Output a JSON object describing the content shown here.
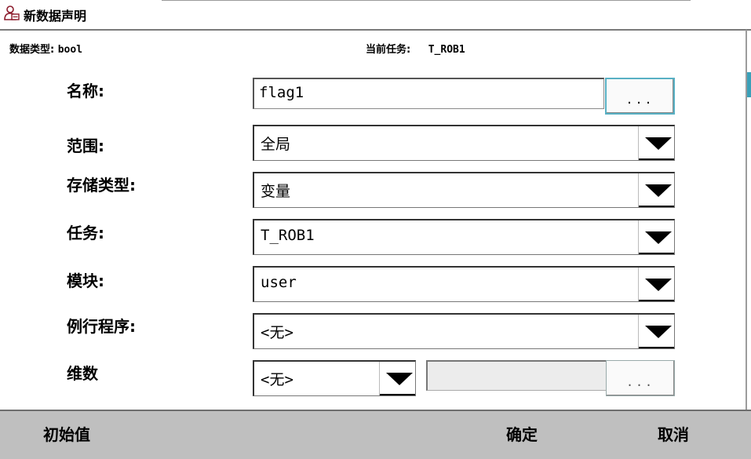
{
  "window": {
    "title": "新数据声明"
  },
  "info": {
    "data_type_label": "数据类型:",
    "data_type_value": "bool",
    "current_task_label": "当前任务:",
    "current_task_value": "T_ROB1"
  },
  "form": {
    "name": {
      "label": "名称:",
      "value": "flag1",
      "browse": "..."
    },
    "scope": {
      "label": "范围:",
      "value": "全局"
    },
    "storage": {
      "label": "存储类型:",
      "value": "变量"
    },
    "task": {
      "label": "任务:",
      "value": "T_ROB1"
    },
    "module": {
      "label": "模块:",
      "value": "user"
    },
    "routine": {
      "label": "例行程序:",
      "value": "<无>"
    },
    "dimension": {
      "label": "维数",
      "value": "<无>",
      "browse": "..."
    }
  },
  "footer": {
    "initial_value": "初始值",
    "ok": "确定",
    "cancel": "取消"
  },
  "colors": {
    "accent": "#3aa0b8",
    "bottom_bar": "#bfbfbf"
  }
}
